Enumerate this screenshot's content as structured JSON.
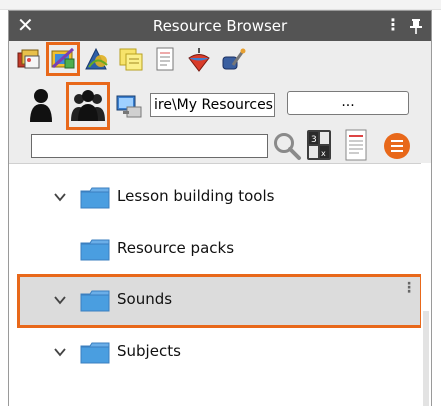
{
  "window": {
    "title": "Resource Browser",
    "close_icon": "close-icon",
    "menu_icon": "vertical-dots-icon",
    "pin_icon": "pin-icon"
  },
  "tabs": [
    {
      "name": "gallery-tab",
      "icon": "gallery-icon",
      "selected": false
    },
    {
      "name": "my-resources-tab",
      "icon": "resources-icon",
      "selected": true
    },
    {
      "name": "shapes-tab",
      "icon": "shapes-icon",
      "selected": false
    },
    {
      "name": "notes-tab",
      "icon": "sticky-notes-icon",
      "selected": false
    },
    {
      "name": "pages-tab",
      "icon": "pages-icon",
      "selected": false
    },
    {
      "name": "spinner-tab",
      "icon": "spinning-top-icon",
      "selected": false
    },
    {
      "name": "tools-tab",
      "icon": "tools-icon",
      "selected": false
    }
  ],
  "location": {
    "path_value": "ire\\My Resources",
    "browse_label": "..."
  },
  "tree": {
    "rows": [
      {
        "label": "Lesson building tools",
        "expandable": true,
        "selected": false
      },
      {
        "label": "Resource packs",
        "expandable": false,
        "selected": false
      },
      {
        "label": "Sounds",
        "expandable": true,
        "selected": true
      },
      {
        "label": "Subjects",
        "expandable": true,
        "selected": false
      }
    ]
  },
  "colors": {
    "accent": "#e8681a",
    "titlebar": "#545454",
    "panel": "#ededed",
    "folder": "#4a9ee0"
  }
}
